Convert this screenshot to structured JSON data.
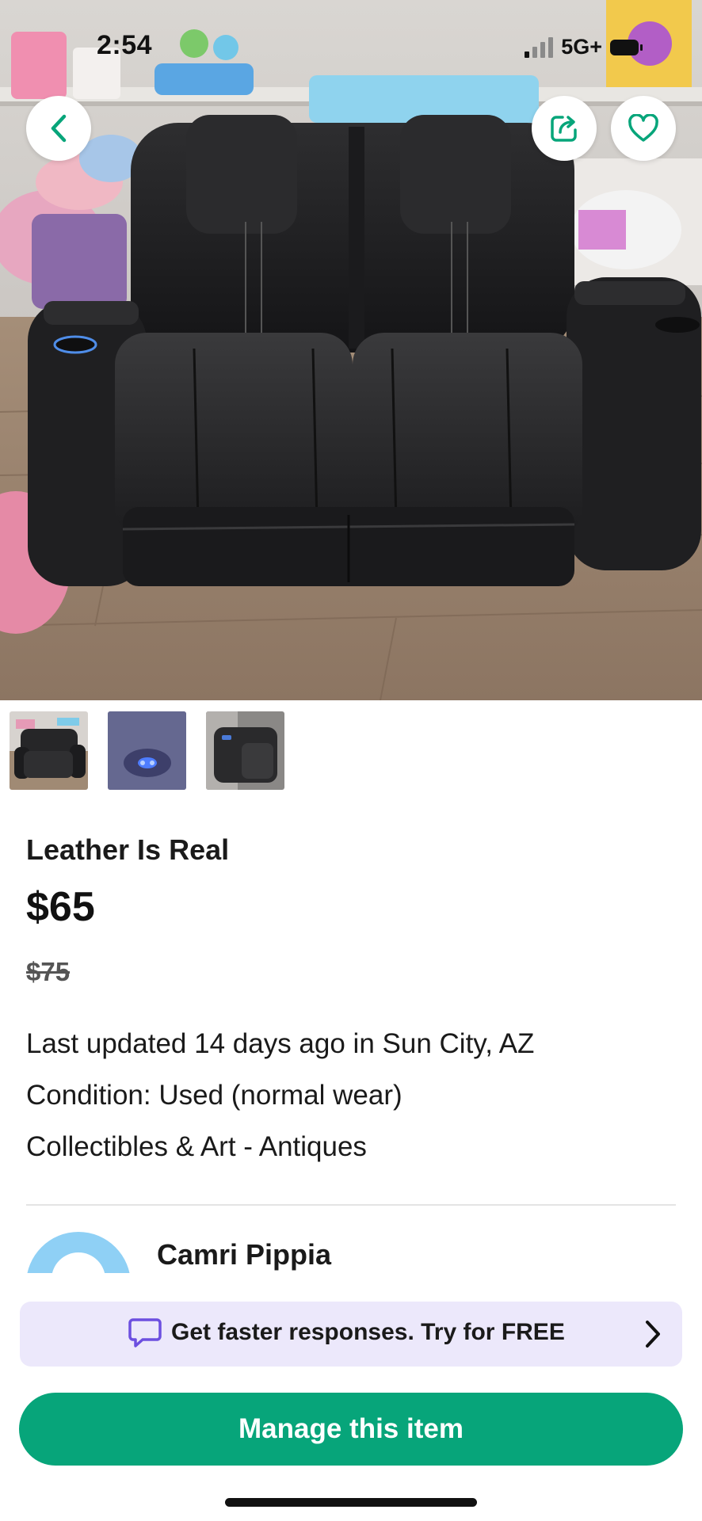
{
  "status_bar": {
    "time": "2:54",
    "network": "5G+"
  },
  "hero": {
    "back_icon": "chevron-left-icon",
    "share_icon": "share-icon",
    "favorite_icon": "heart-icon"
  },
  "thumbnails": [
    {
      "label": "photo-1"
    },
    {
      "label": "photo-2"
    },
    {
      "label": "photo-3"
    }
  ],
  "listing": {
    "title": "Leather Is Real",
    "price": "$65",
    "original_price": "$75",
    "last_updated": "Last updated 14 days ago in Sun City, AZ",
    "condition": "Condition: Used (normal wear)",
    "category": "Collectibles & Art - Antiques"
  },
  "seller": {
    "name": "Camri Pippia"
  },
  "promo": {
    "text": "Get faster responses. Try for FREE",
    "icon": "chat-bubble-icon",
    "chevron": "chevron-right-icon"
  },
  "cta": {
    "label": "Manage this item"
  },
  "colors": {
    "brand_green": "#07a57a",
    "promo_bg": "#ece8fb",
    "promo_icon": "#6c4fe0",
    "avatar": "#8fd0f5"
  }
}
